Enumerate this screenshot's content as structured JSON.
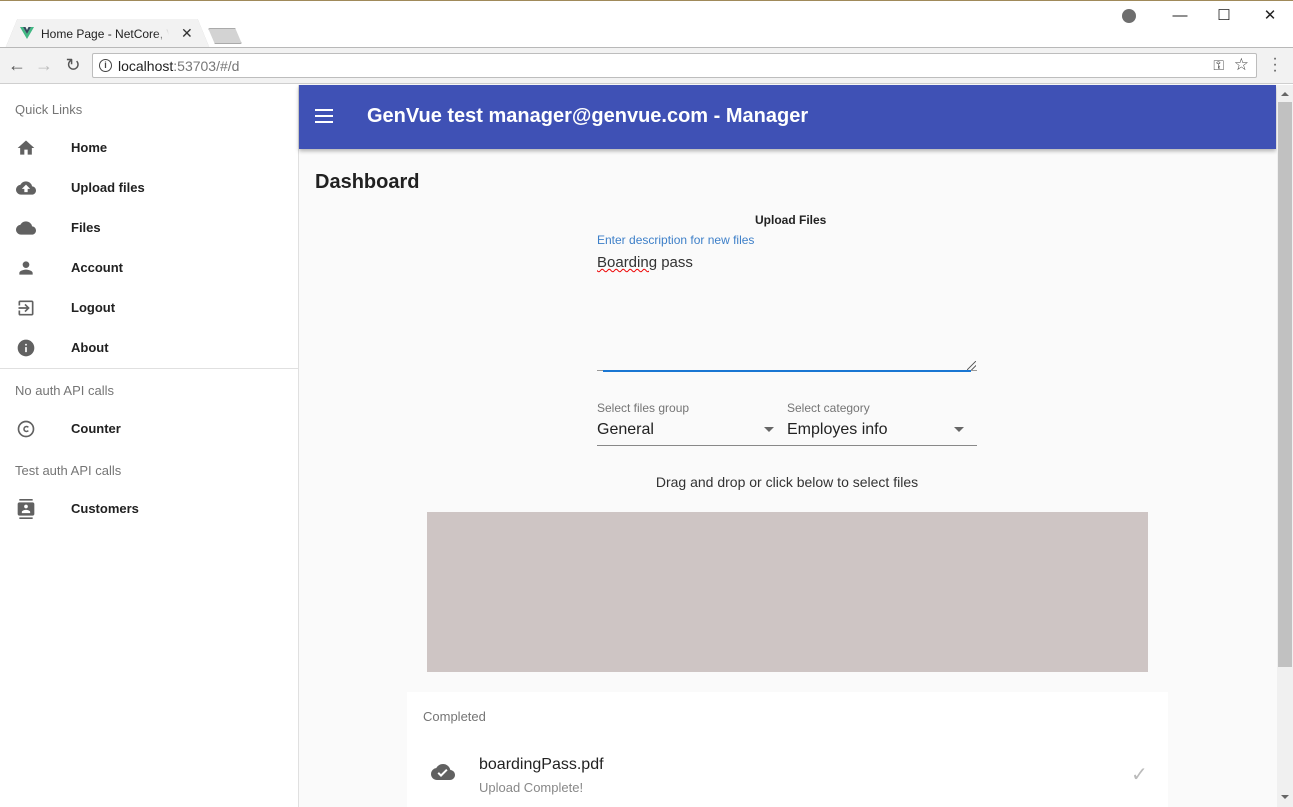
{
  "browser": {
    "tab_title": "Home Page - NetCore, Vue",
    "url_host": "localhost",
    "url_rest": ":53703/#/d",
    "window_controls": {
      "minimize": "—",
      "maximize": "☐",
      "close": "✕"
    },
    "icons": {
      "back": "←",
      "forward": "→",
      "reload": "↻",
      "info": "i",
      "key": "⚿",
      "star": "☆",
      "menu": "⋮",
      "tab_close": "✕"
    }
  },
  "sidebar": {
    "sections": [
      {
        "title": "Quick Links"
      },
      {
        "title": "No auth API calls"
      },
      {
        "title": "Test auth API calls"
      }
    ],
    "items": [
      {
        "label": "Home",
        "icon": "home-icon"
      },
      {
        "label": "Upload files",
        "icon": "cloud-upload-icon"
      },
      {
        "label": "Files",
        "icon": "cloud-icon"
      },
      {
        "label": "Account",
        "icon": "person-icon"
      },
      {
        "label": "Logout",
        "icon": "exit-icon"
      },
      {
        "label": "About",
        "icon": "info-icon"
      },
      {
        "label": "Counter",
        "icon": "copyright-icon"
      },
      {
        "label": "Customers",
        "icon": "contacts-icon"
      }
    ]
  },
  "appbar": {
    "title": "GenVue test manager@genvue.com - Manager",
    "color": "#3f51b5"
  },
  "main": {
    "page_title": "Dashboard",
    "upload": {
      "heading": "Upload Files",
      "description_label": "Enter description for new files",
      "description_value_word1": "Boarding",
      "description_value_rest": " pass",
      "group_label": "Select files group",
      "group_value": "General",
      "category_label": "Select category",
      "category_value": "Employes info",
      "dnd_text": "Drag and drop or click below to select files"
    },
    "completed": {
      "subheader": "Completed",
      "files": [
        {
          "name": "boardingPass.pdf",
          "status": "Upload Complete!"
        }
      ]
    }
  }
}
